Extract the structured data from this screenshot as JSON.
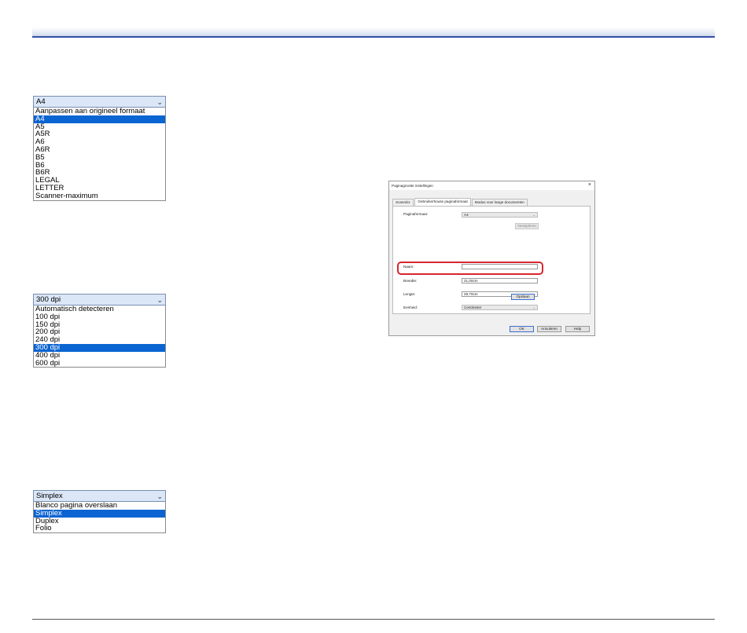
{
  "paper_format_list": {
    "selected": "A4",
    "options": [
      "Aanpassen aan origineel formaat",
      "A4",
      "A5",
      "A5R",
      "A6",
      "A6R",
      "B5",
      "B6",
      "B6R",
      "LEGAL",
      "LETTER",
      "Scanner-maximum"
    ],
    "highlighted_index": 1
  },
  "dpi_list": {
    "selected": "300 dpi",
    "options": [
      "Automatisch detecteren",
      "100 dpi",
      "150 dpi",
      "200 dpi",
      "240 dpi",
      "300 dpi",
      "400 dpi",
      "600 dpi"
    ],
    "highlighted_index": 5
  },
  "scan_side_list": {
    "selected": "Simplex",
    "options": [
      "Blanco pagina overslaan",
      "Simplex",
      "Duplex",
      "Folio"
    ],
    "highlighted_index": 1
  },
  "dialog": {
    "title": "Paginagrootte instellingen",
    "close_glyph": "×",
    "tabs": [
      "Scanrdct.",
      "Gebruikerhouse paginaformaat",
      "Modus voor lange documenten"
    ],
    "paper_format_label": "Paginaformaat:",
    "paper_format_value": "A4",
    "delete_button": "Verwijderen",
    "name_label": "Naam:",
    "name_value": "",
    "width_label": "Breedte:",
    "width_value": "21,00cm",
    "length_label": "Lengte:",
    "length_value": "29,70cm",
    "unit_label": "Eenheid:",
    "unit_value": "Centimeter",
    "save_button": "Opslaan",
    "ok_button": "OK",
    "cancel_button": "Annuleren",
    "help_button": "Help"
  },
  "icons": {
    "chevron": "chevron-down-icon",
    "close": "close-icon"
  },
  "colors": {
    "selection": "#0a64d2",
    "header_rule": "#3350a8",
    "highlight_box": "#d8262e"
  }
}
